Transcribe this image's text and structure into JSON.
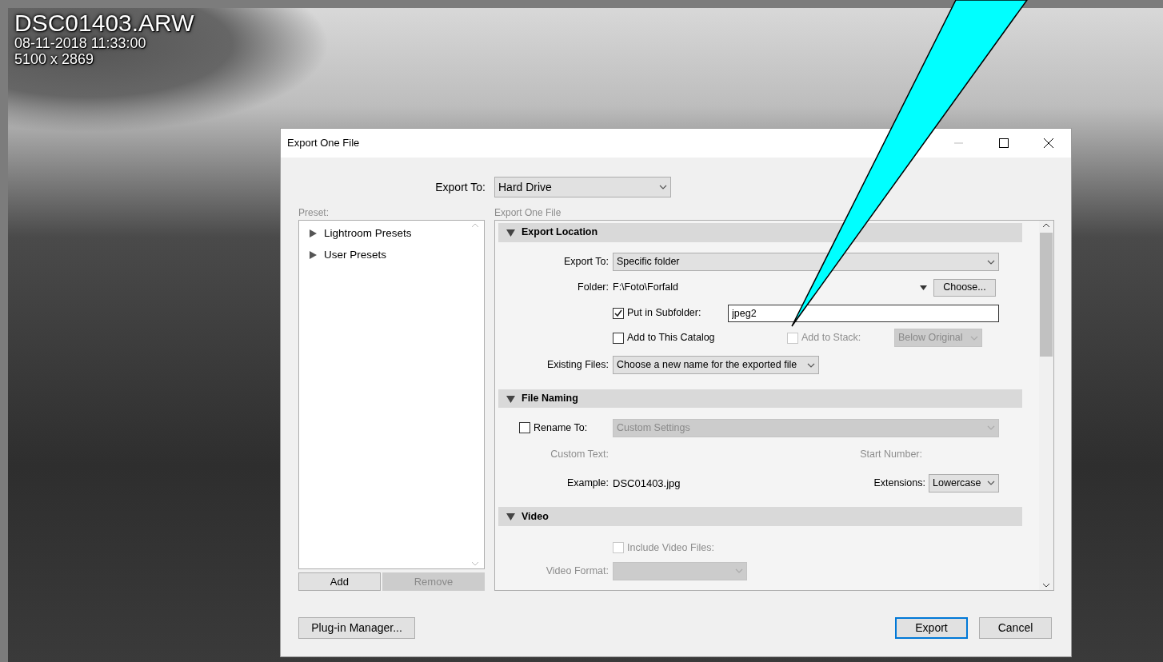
{
  "photo": {
    "filename": "DSC01403.ARW",
    "datetime": "08-11-2018 11:33:00",
    "dimensions": "5100 x 2869"
  },
  "dialog": {
    "title": "Export One File",
    "export_to": {
      "label": "Export To:",
      "value": "Hard Drive"
    },
    "preset": {
      "label": "Preset:",
      "items": [
        {
          "label": "Lightroom Presets",
          "expanded": false
        },
        {
          "label": "User Presets",
          "expanded": false
        }
      ],
      "buttons": [
        {
          "label": "Add",
          "disabled": false
        },
        {
          "label": "Remove",
          "disabled": true
        }
      ]
    },
    "panel": {
      "title": "Export One File",
      "sections": [
        {
          "kind": "export_location",
          "title": "Export Location",
          "expanded": true,
          "export_to": {
            "label": "Export To:",
            "value": "Specific folder"
          },
          "folder": {
            "label": "Folder:",
            "value": "F:\\Foto\\Forfald",
            "button": "Choose..."
          },
          "subfolder": {
            "label": "Put in Subfolder:",
            "checked": true,
            "value": "jpeg2"
          },
          "add_to_catalog": {
            "label": "Add to This Catalog",
            "checked": false
          },
          "add_to_stack": {
            "label": "Add to Stack:",
            "checked": false,
            "disabled": true,
            "value": "Below Original"
          },
          "existing_files": {
            "label": "Existing Files:",
            "value": "Choose a new name for the exported file"
          }
        },
        {
          "kind": "file_naming",
          "title": "File Naming",
          "expanded": true,
          "rename": {
            "label": "Rename To:",
            "checked": false,
            "disabled": true,
            "value": "Custom Settings"
          },
          "custom_text": {
            "label": "Custom Text:"
          },
          "start_number": {
            "label": "Start Number:"
          },
          "example": {
            "label": "Example:",
            "value": "DSC01403.jpg"
          },
          "extensions": {
            "label": "Extensions:",
            "value": "Lowercase"
          }
        },
        {
          "kind": "video",
          "title": "Video",
          "expanded": true,
          "include": {
            "label": "Include Video Files:",
            "checked": false,
            "disabled": true
          },
          "video_format": {
            "label": "Video Format:"
          }
        }
      ]
    },
    "footer": {
      "left": "Plug-in Manager...",
      "buttons": [
        {
          "label": "Export",
          "default": true
        },
        {
          "label": "Cancel",
          "default": false
        }
      ]
    }
  }
}
